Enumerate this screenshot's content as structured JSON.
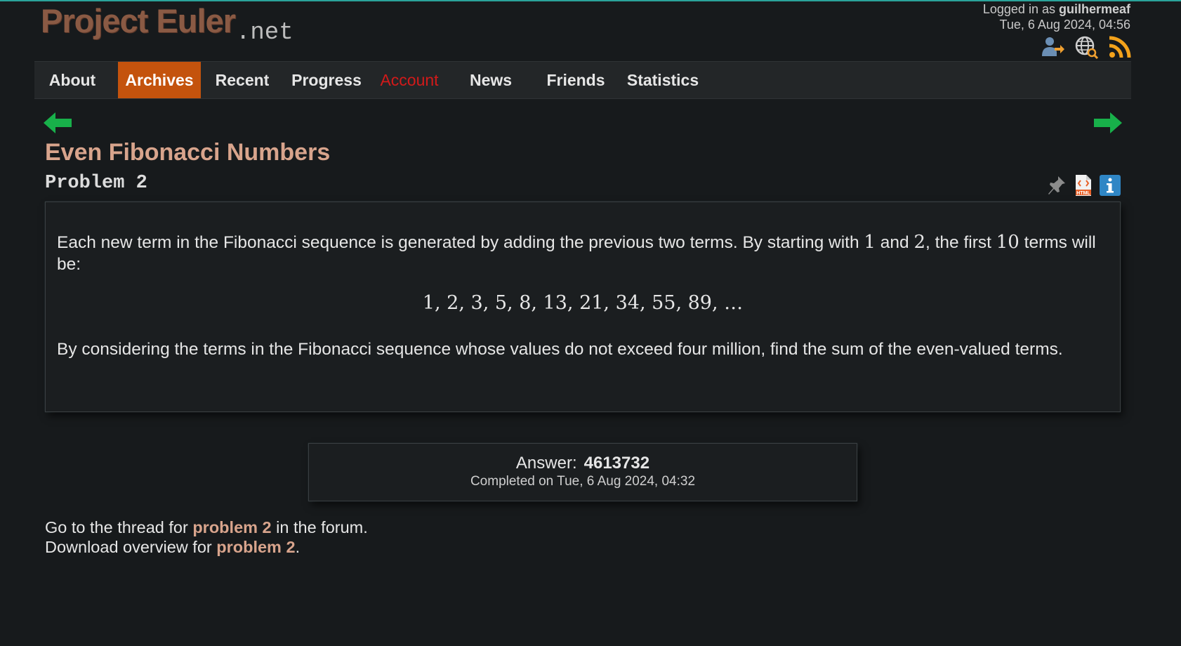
{
  "header": {
    "logo_main": "Project Euler",
    "logo_net": ".net",
    "logged_in_prefix": "Logged in as ",
    "username": "guilhermeaf",
    "datetime": "Tue, 6 Aug 2024, 04:56"
  },
  "nav": {
    "items": [
      {
        "label": "About"
      },
      {
        "label": "Archives"
      },
      {
        "label": "Recent"
      },
      {
        "label": "Progress"
      },
      {
        "label": "Account"
      },
      {
        "label": "News"
      },
      {
        "label": "Friends"
      },
      {
        "label": "Statistics"
      }
    ],
    "active": "Archives"
  },
  "problem": {
    "title": "Even Fibonacci Numbers",
    "subtitle": "Problem 2",
    "p1_a": "Each new term in the Fibonacci sequence is generated by adding the previous two terms. By starting with ",
    "p1_m1": "1",
    "p1_b": " and ",
    "p1_m2": "2",
    "p1_c": ", the first ",
    "p1_m3": "10",
    "p1_d": " terms will be:",
    "sequence": "1, 2, 3, 5, 8, 13, 21, 34, 55, 89, …",
    "p2": "By considering the terms in the Fibonacci sequence whose values do not exceed four million, find the sum of the even-valued terms."
  },
  "answer": {
    "label": "Answer:",
    "value": "4613732",
    "completed": "Completed on Tue, 6 Aug 2024, 04:32"
  },
  "footer": {
    "line1_a": "Go to the thread for ",
    "line1_link": "problem 2",
    "line1_b": " in the forum.",
    "line2_a": "Download overview for ",
    "line2_link": "problem 2",
    "line2_b": "."
  },
  "colors": {
    "background": "#171a1c",
    "nav_active": "#c4530d",
    "account": "#d21a1a",
    "accent_link": "#d8a48c",
    "arrow_green": "#18b04a"
  },
  "icons": [
    "add-friend-icon",
    "globe-search-icon",
    "rss-icon",
    "pin-icon",
    "html-file-icon",
    "info-icon",
    "previous-arrow-icon",
    "next-arrow-icon"
  ]
}
